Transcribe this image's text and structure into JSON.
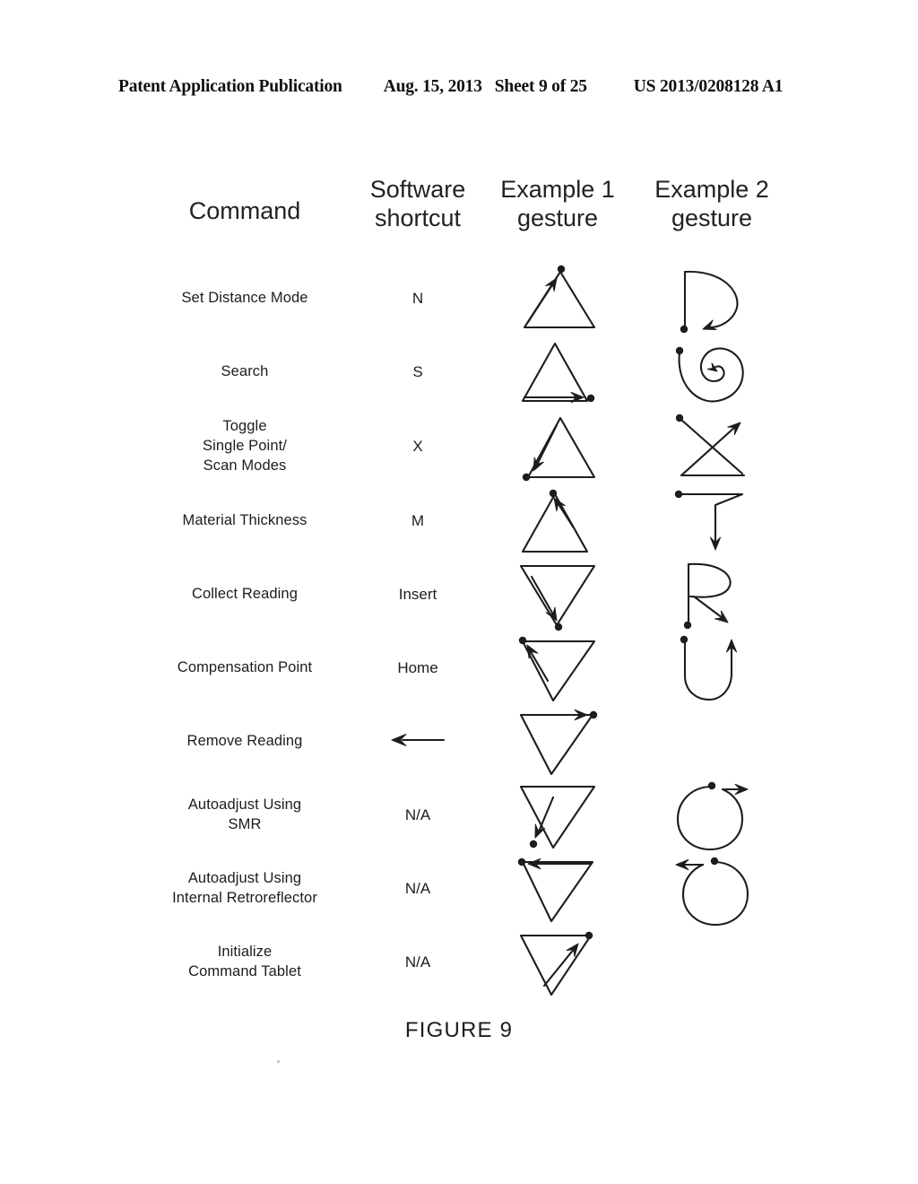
{
  "header": {
    "publication": "Patent Application Publication",
    "date": "Aug. 15, 2013",
    "sheet": "Sheet 9 of 25",
    "patent_number": "US 2013/0208128 A1"
  },
  "table": {
    "columns": [
      {
        "label_line1": "Command",
        "label_line2": ""
      },
      {
        "label_line1": "Software",
        "label_line2": "shortcut"
      },
      {
        "label_line1": "Example 1",
        "label_line2": "gesture"
      },
      {
        "label_line1": "Example 2",
        "label_line2": "gesture"
      }
    ],
    "rows": [
      {
        "command": "Set Distance Mode",
        "shortcut": "N",
        "example1": "triangle-up-arrow-to-apex-dot",
        "example2": "letter-d-arc-arrow"
      },
      {
        "command": "Search",
        "shortcut": "S",
        "example1": "triangle-up-arrow-right-base-dot",
        "example2": "inward-spiral"
      },
      {
        "command": "Toggle\nSingle Point/\nScan Modes",
        "shortcut": "X",
        "example1": "triangle-up-arrow-down-left-dot",
        "example2": "cross-x-arrow-up-right"
      },
      {
        "command": "Material Thickness",
        "shortcut": "M",
        "example1": "triangle-up-arrow-up-left-apex-dot",
        "example2": "letter-t-arrow-down"
      },
      {
        "command": "Collect Reading",
        "shortcut": "Insert",
        "example1": "triangle-down-arrow-to-bottom-dot",
        "example2": "letter-r-arrow-down-right"
      },
      {
        "command": "Compensation Point",
        "shortcut": "Home",
        "example1": "triangle-down-arrow-up-left-dot",
        "example2": "letter-u-arrow-up"
      },
      {
        "command": "Remove Reading",
        "shortcut": "←",
        "example1": "triangle-down-arrow-right-top-dot",
        "example2": ""
      },
      {
        "command": "Autoadjust Using\nSMR",
        "shortcut": "N/A",
        "example1": "triangle-down-arrow-down-left-dot",
        "example2": "circle-counterclockwise-arrow-right"
      },
      {
        "command": "Autoadjust Using\nInternal Retroreflector",
        "shortcut": "N/A",
        "example1": "triangle-down-arrow-left-top-dot",
        "example2": "circle-clockwise-arrow-left"
      },
      {
        "command": "Initialize\nCommand Tablet",
        "shortcut": "N/A",
        "example1": "triangle-down-arrow-up-right-dot",
        "example2": ""
      }
    ]
  },
  "figure": {
    "caption": "FIGURE 9"
  },
  "colors": {
    "ink": "#1d1d1d",
    "page": "#ffffff"
  }
}
